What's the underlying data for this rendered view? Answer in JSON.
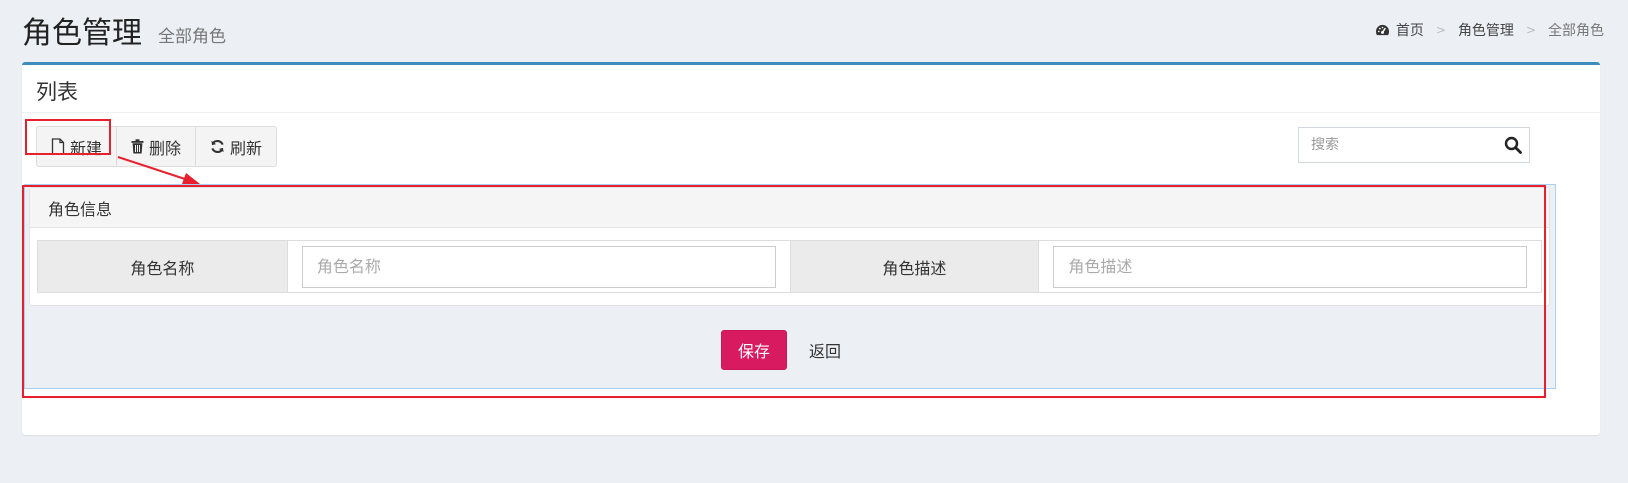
{
  "header": {
    "title": "角色管理",
    "subtitle": "全部角色"
  },
  "breadcrumb": {
    "items": [
      "首页",
      "角色管理",
      "全部角色"
    ],
    "separator": ">"
  },
  "box": {
    "title": "列表",
    "accent_color": "#3c8dbc"
  },
  "toolbar": {
    "new_label": "新建",
    "delete_label": "删除",
    "refresh_label": "刷新"
  },
  "search": {
    "placeholder": "搜索",
    "value": ""
  },
  "form": {
    "heading": "角色信息",
    "fields": [
      {
        "label": "角色名称",
        "placeholder": "角色名称",
        "value": ""
      },
      {
        "label": "角色描述",
        "placeholder": "角色描述",
        "value": ""
      }
    ],
    "save_label": "保存",
    "back_label": "返回",
    "save_color": "#d81b60"
  },
  "annotation_color": "#e8202e"
}
